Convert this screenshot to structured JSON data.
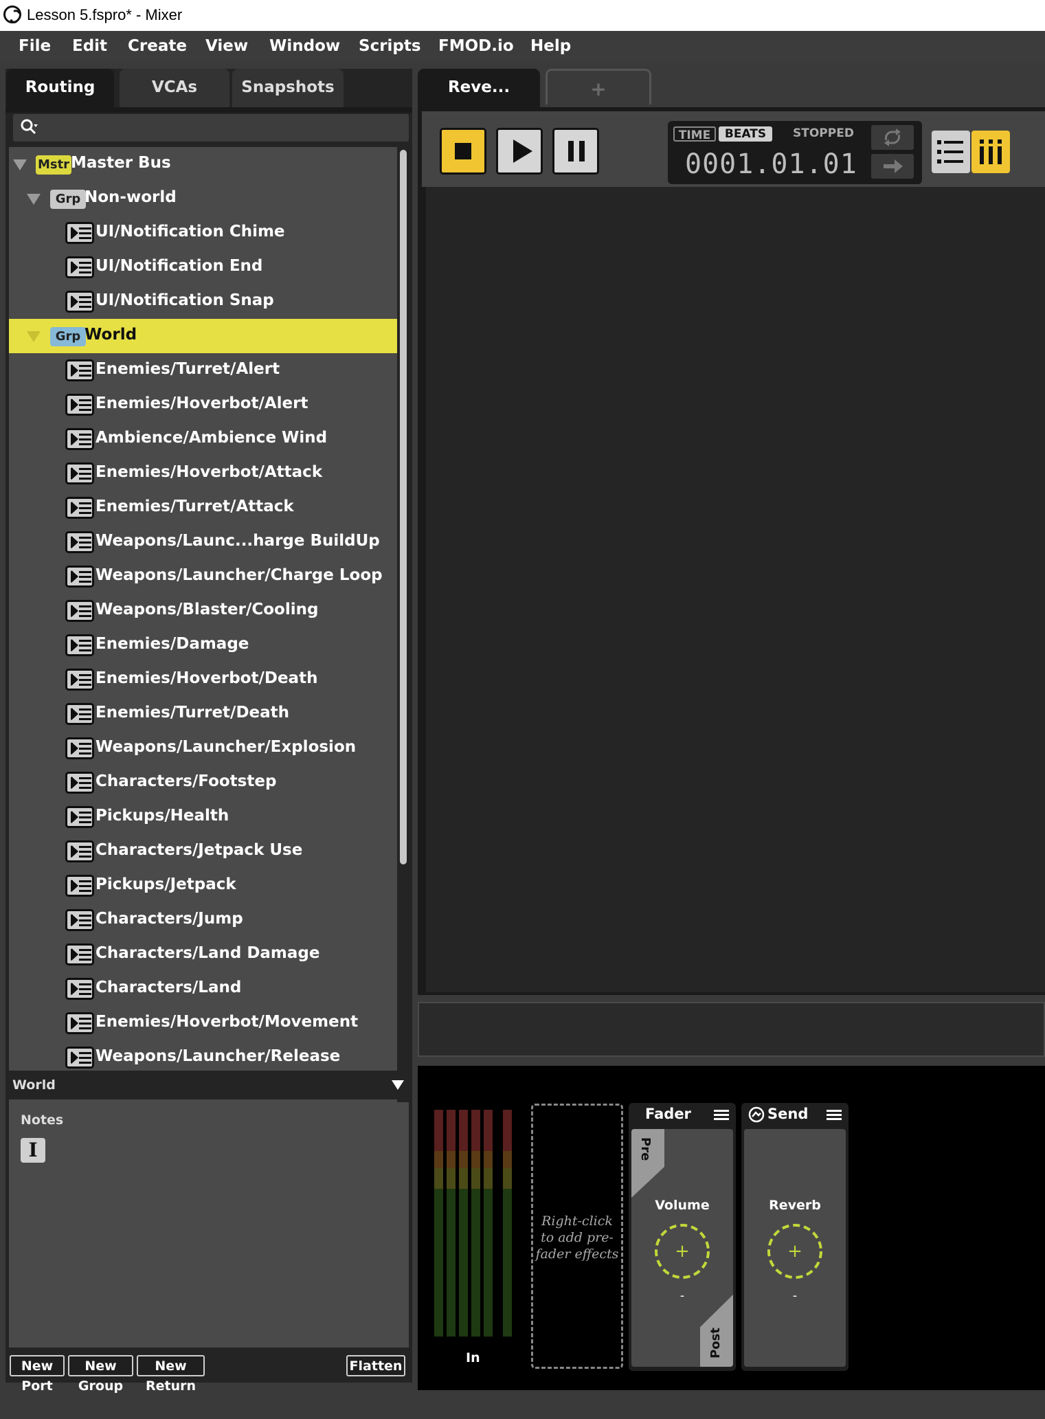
{
  "window": {
    "title": "Lesson 5.fspro* - Mixer"
  },
  "menu": [
    "File",
    "Edit",
    "Create",
    "View",
    "Window",
    "Scripts",
    "FMOD.io",
    "Help"
  ],
  "left_tabs": [
    "Routing",
    "VCAs",
    "Snapshots"
  ],
  "search": {
    "placeholder": ""
  },
  "tree": {
    "master": {
      "badge": "Mstr",
      "label": "Master Bus"
    },
    "groups": [
      {
        "badge": "Grp",
        "label": "Non-world",
        "events": [
          "UI/Notification Chime",
          "UI/Notification End",
          "UI/Notification Snap"
        ]
      },
      {
        "badge": "Grp",
        "label": "World",
        "selected": true,
        "events": [
          "Enemies/Turret/Alert",
          "Enemies/Hoverbot/Alert",
          "Ambience/Ambience Wind",
          "Enemies/Hoverbot/Attack",
          "Enemies/Turret/Attack",
          "Weapons/Launc...harge BuildUp",
          "Weapons/Launcher/Charge Loop",
          "Weapons/Blaster/Cooling",
          "Enemies/Damage",
          "Enemies/Hoverbot/Death",
          "Enemies/Turret/Death",
          "Weapons/Launcher/Explosion",
          "Characters/Footstep",
          "Pickups/Health",
          "Characters/Jetpack Use",
          "Pickups/Jetpack",
          "Characters/Jump",
          "Characters/Land Damage",
          "Characters/Land",
          "Enemies/Hoverbot/Movement",
          "Weapons/Launcher/Release"
        ]
      }
    ]
  },
  "properties": {
    "title": "World",
    "notes_label": "Notes",
    "text_tool": "I"
  },
  "bottom_buttons": [
    "New Port",
    "New Group",
    "New Return",
    "Flatten"
  ],
  "right_tabs": {
    "active": "Reve...",
    "add": "+"
  },
  "transport": {
    "time_label": "TIME",
    "beats_label": "BEATS",
    "status": "STOPPED",
    "position": "0001.01.01",
    "active_view": "strip"
  },
  "deck": {
    "input_label": "In",
    "prefader_hint": "Right-click to add pre-fader effects",
    "fader": {
      "title": "Fader",
      "param": "Volume",
      "pre": "Pre",
      "post": "Post",
      "min": "-",
      "center": "+"
    },
    "send": {
      "title": "Send",
      "param": "Reverb",
      "min": "-",
      "center": "+"
    }
  },
  "colors": {
    "accent": "#e6e045",
    "knob": "#c3d83a",
    "stop": "#f0c531"
  }
}
